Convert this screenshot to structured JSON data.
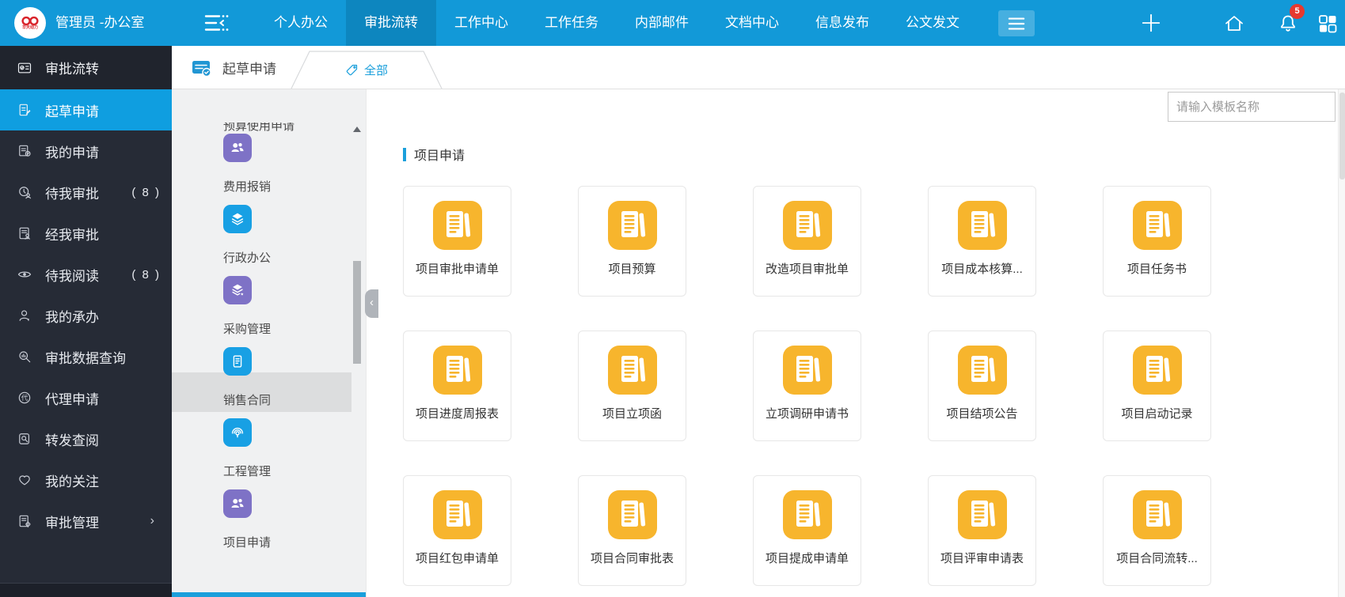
{
  "topbar": {
    "logo_text": "华天动力",
    "user_name": "管理员 -办公室",
    "nav_items": [
      {
        "label": "个人办公",
        "active": false
      },
      {
        "label": "审批流转",
        "active": true
      },
      {
        "label": "工作中心",
        "active": false
      },
      {
        "label": "工作任务",
        "active": false
      },
      {
        "label": "内部邮件",
        "active": false
      },
      {
        "label": "文档中心",
        "active": false
      },
      {
        "label": "信息发布",
        "active": false
      },
      {
        "label": "公文发文",
        "active": false
      }
    ],
    "notification_badge": "5"
  },
  "sidebar": {
    "module_title": "审批流转",
    "items": [
      {
        "label": "起草申请",
        "count": "",
        "active": true
      },
      {
        "label": "我的申请",
        "count": ""
      },
      {
        "label": "待我审批",
        "count": "( 8 )"
      },
      {
        "label": "经我审批",
        "count": ""
      },
      {
        "label": "待我阅读",
        "count": "( 8 )"
      },
      {
        "label": "我的承办",
        "count": ""
      },
      {
        "label": "审批数据查询",
        "count": ""
      },
      {
        "label": "代理申请",
        "count": ""
      },
      {
        "label": "转发查阅",
        "count": ""
      },
      {
        "label": "我的关注",
        "count": ""
      },
      {
        "label": "审批管理",
        "count": "",
        "has_submenu": true
      }
    ]
  },
  "tabbar": {
    "title": "起草申请",
    "active_tab": "全部"
  },
  "search": {
    "placeholder": "请输入模板名称"
  },
  "categories": {
    "partial_label": "预算使用申请",
    "items": [
      {
        "label": "费用报销",
        "color": "#7e72c6"
      },
      {
        "label": "行政办公",
        "color": "#18a0e4"
      },
      {
        "label": "采购管理",
        "color": "#7e72c6"
      },
      {
        "label": "销售合同",
        "color": "#18a0e4",
        "selected": true
      },
      {
        "label": "工程管理",
        "color": "#18a0e4"
      },
      {
        "label": "项目申请",
        "color": "#7e72c6"
      }
    ]
  },
  "main": {
    "section_title": "项目申请",
    "cards": [
      "项目审批申请单",
      "项目预算",
      "改造项目审批单",
      "项目成本核算...",
      "项目任务书",
      "项目进度周报表",
      "项目立项函",
      "立项调研申请书",
      "项目结项公告",
      "项目启动记录",
      "项目红包申请单",
      "项目合同审批表",
      "项目提成申请单",
      "项目评审申请表",
      "项目合同流转..."
    ]
  },
  "icons": {
    "collapse_left": "‹",
    "chevron_right": "›",
    "scroll_up": ""
  },
  "colors": {
    "topbar_blue": "#1299d8",
    "active_nav_blue": "#0d86bf",
    "sidebar_dark": "#262b36",
    "active_item_blue": "#0f9ee0",
    "accent_blue": "#1a9fdb",
    "card_icon_yellow": "#f7b52d",
    "category_purple": "#7e72c6",
    "category_blue": "#18a0e4",
    "badge_red": "#e7392f"
  }
}
